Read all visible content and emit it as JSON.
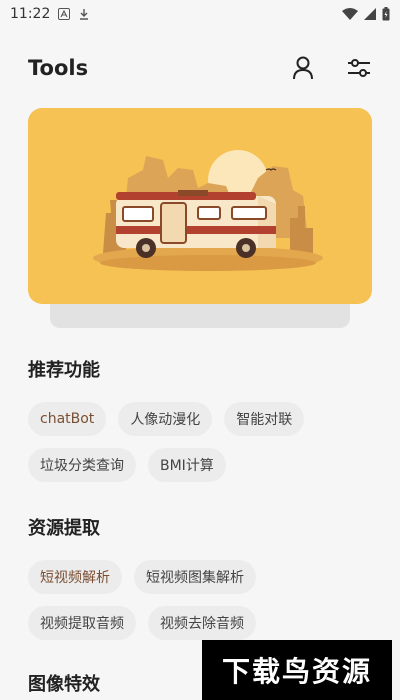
{
  "status": {
    "time": "11:22"
  },
  "header": {
    "title": "Tools",
    "profile_icon": "user-icon",
    "settings_icon": "sliders-icon"
  },
  "sections": [
    {
      "title": "推荐功能",
      "items": [
        "chatBot",
        "人像动漫化",
        "智能对联",
        "垃圾分类查询",
        "BMI计算"
      ]
    },
    {
      "title": "资源提取",
      "items": [
        "短视频解析",
        "短视频图集解析",
        "视频提取音频",
        "视频去除音频"
      ]
    },
    {
      "title": "图像特效",
      "items": []
    }
  ],
  "watermark": "下载鸟资源",
  "colors": {
    "banner": "#f5c253",
    "chip_bg": "#ececec",
    "chip_text_warm": "#7a4f33"
  }
}
